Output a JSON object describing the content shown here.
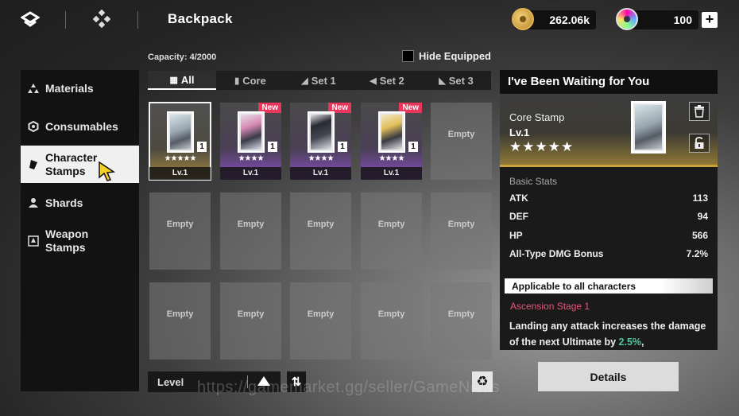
{
  "header": {
    "title": "Backpack",
    "gold": "262.06k",
    "gems": "100",
    "plus": "+"
  },
  "capacity": "Capacity: 4/2000",
  "hide_equipped": "Hide Equipped",
  "sidebar": {
    "items": [
      {
        "label": "Materials",
        "icon": "materials-icon"
      },
      {
        "label": "Consumables",
        "icon": "consumables-icon"
      },
      {
        "label": "Character Stamps",
        "icon": "character-stamp-icon",
        "active": true
      },
      {
        "label": "Shards",
        "icon": "shards-icon"
      },
      {
        "label": "Weapon Stamps",
        "icon": "weapon-stamp-icon"
      }
    ]
  },
  "tabs": [
    {
      "label": "All",
      "active": true
    },
    {
      "label": "Core"
    },
    {
      "label": "Set 1"
    },
    {
      "label": "Set 2"
    },
    {
      "label": "Set 3"
    }
  ],
  "grid": {
    "items": [
      {
        "qty": "1",
        "stars": "★★★★★",
        "level": "Lv.1",
        "rarity": "gold",
        "new": false,
        "selected": true
      },
      {
        "qty": "1",
        "stars": "★★★★",
        "level": "Lv.1",
        "rarity": "purple",
        "new": true,
        "new_label": "New"
      },
      {
        "qty": "1",
        "stars": "★★★★",
        "level": "Lv.1",
        "rarity": "purple",
        "new": true,
        "new_label": "New"
      },
      {
        "qty": "1",
        "stars": "★★★★",
        "level": "Lv.1",
        "rarity": "purple",
        "new": true,
        "new_label": "New"
      }
    ],
    "empty_label": "Empty"
  },
  "sort": {
    "label": "Level",
    "swap": "⇅"
  },
  "detail": {
    "title": "I've Been Waiting for You",
    "type": "Core Stamp",
    "level": "Lv.1",
    "stars": "★★★★★",
    "stats_heading": "Basic Stats",
    "stats": [
      {
        "name": "ATK",
        "value": "113"
      },
      {
        "name": "DEF",
        "value": "94"
      },
      {
        "name": "HP",
        "value": "566"
      },
      {
        "name": "All-Type DMG Bonus",
        "value": "7.2%"
      }
    ],
    "applicable": "Applicable to all characters",
    "ascension": "Ascension Stage 1",
    "desc_a": "Landing any attack increases the damage of the next Ultimate by ",
    "desc_hl": "2.5%",
    "desc_b": ","
  },
  "details_button": "Details",
  "watermark": "https://gamemarket.gg/seller/GameNews"
}
